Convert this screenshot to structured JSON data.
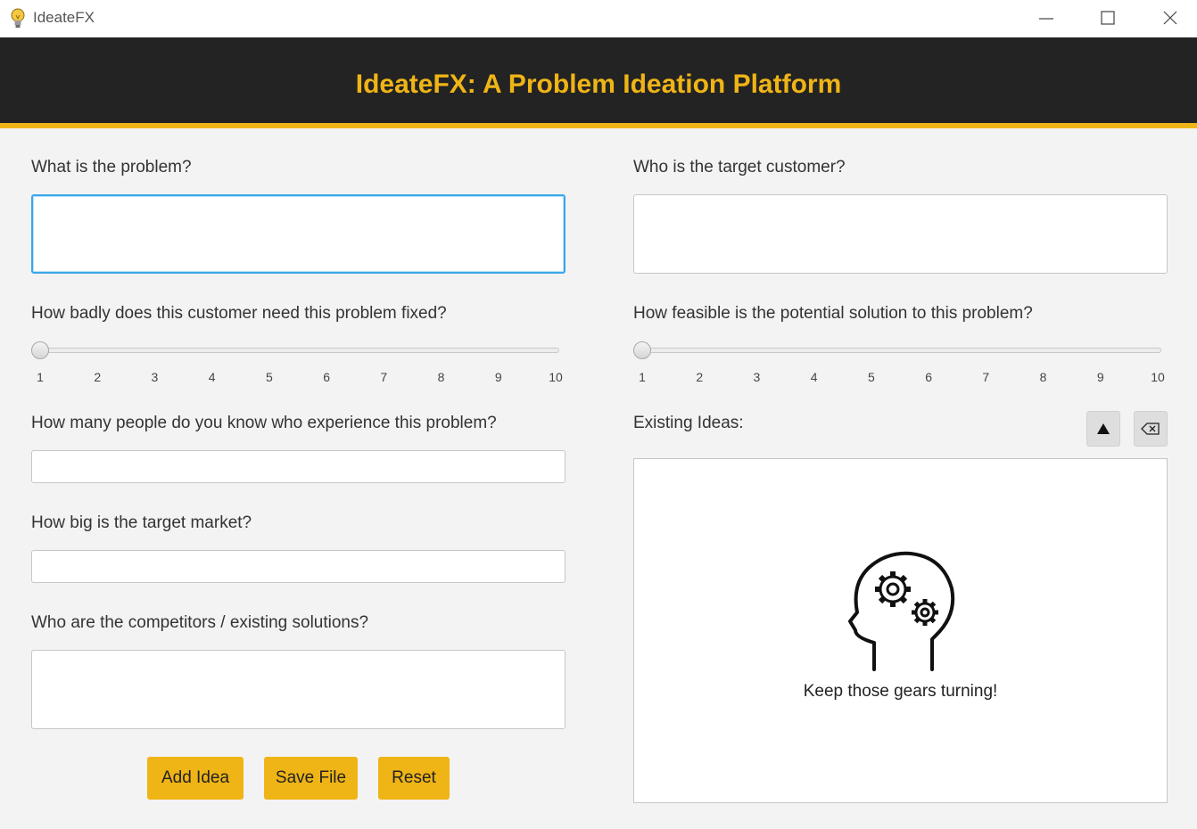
{
  "window": {
    "title": "IdeateFX"
  },
  "header": {
    "title": "IdeateFX: A Problem Ideation Platform"
  },
  "form": {
    "problem_label": "What is the problem?",
    "problem_value": "",
    "customer_label": "Who is the target customer?",
    "customer_value": "",
    "need_label": "How badly does this customer need this problem fixed?",
    "need_value": 1,
    "feasible_label": "How feasible is the potential solution to this problem?",
    "feasible_value": 1,
    "people_label": "How many people do you know who experience this problem?",
    "people_value": "",
    "market_label": "How big is the target market?",
    "market_value": "",
    "competitors_label": "Who are the competitors / existing solutions?",
    "competitors_value": ""
  },
  "slider_ticks": [
    "1",
    "2",
    "3",
    "4",
    "5",
    "6",
    "7",
    "8",
    "9",
    "10"
  ],
  "ideas": {
    "label": "Existing Ideas:",
    "empty_text": "Keep those gears turning!",
    "sort_icon": "triangle-up-icon",
    "clear_icon": "eraser-icon"
  },
  "buttons": {
    "add": "Add Idea",
    "save": "Save File",
    "reset": "Reset"
  },
  "colors": {
    "accent": "#efb416",
    "header_bg": "#232323",
    "focus": "#39a7ea"
  }
}
